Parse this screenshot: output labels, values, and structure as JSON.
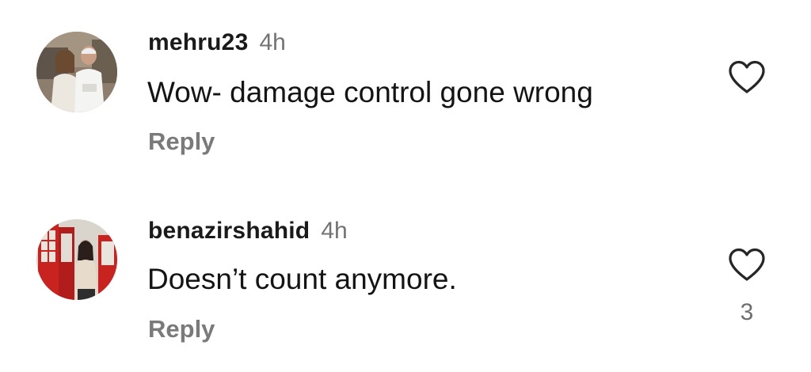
{
  "comments": [
    {
      "username": "mehru23",
      "time": "4h",
      "text": "Wow- damage control gone wrong",
      "reply_label": "Reply",
      "like_count": ""
    },
    {
      "username": "benazirshahid",
      "time": "4h",
      "text": "Doesn’t count anymore.",
      "reply_label": "Reply",
      "like_count": "3"
    }
  ],
  "icons": {
    "like": "heart-outline-icon",
    "avatar": "profile-photo"
  },
  "colors": {
    "background": "#ffffff",
    "username": "#1a1a1a",
    "text": "#141414",
    "secondary": "#737373",
    "reply": "#7a7a7a",
    "icon_stroke": "#262626"
  }
}
